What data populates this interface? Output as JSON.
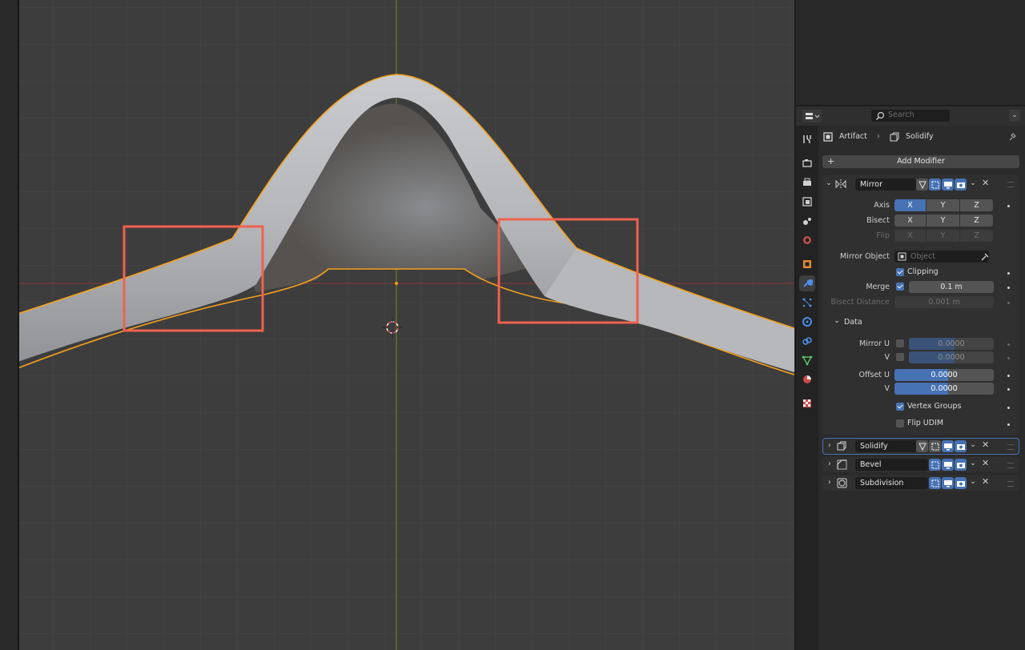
{
  "viewport": {
    "grid_color": "#454545",
    "bg_color": "#3d3d3d",
    "x_axis_color": "#a33a3a",
    "y_axis_color": "#7e9b2a",
    "selection_outline_color": "#f5a11f",
    "annotation_color": "#f0614f"
  },
  "header": {
    "search_placeholder": "Search"
  },
  "breadcrumb": {
    "object": "Artifact",
    "modifier": "Solidify"
  },
  "add_modifier_label": "Add Modifier",
  "mirror": {
    "name": "Mirror",
    "axis_label": "Axis",
    "bisect_label": "Bisect",
    "flip_label": "Flip",
    "axes": [
      "X",
      "Y",
      "Z"
    ],
    "mirror_object_label": "Mirror Object",
    "mirror_object_placeholder": "Object",
    "clipping_label": "Clipping",
    "merge_label": "Merge",
    "merge_value": "0.1 m",
    "bisect_distance_label": "Bisect Distance",
    "bisect_distance_value": "0.001 m",
    "data_label": "Data",
    "mirror_u_label": "Mirror U",
    "v_label": "V",
    "mirror_u_value": "0.0000",
    "mirror_v_value": "0.0000",
    "offset_u_label": "Offset U",
    "offset_u_value": "0.0000",
    "offset_v_value": "0.0000",
    "vertex_groups_label": "Vertex Groups",
    "flip_udim_label": "Flip UDIM"
  },
  "modifiers": [
    {
      "name": "Solidify"
    },
    {
      "name": "Bevel"
    },
    {
      "name": "Subdivision"
    }
  ]
}
